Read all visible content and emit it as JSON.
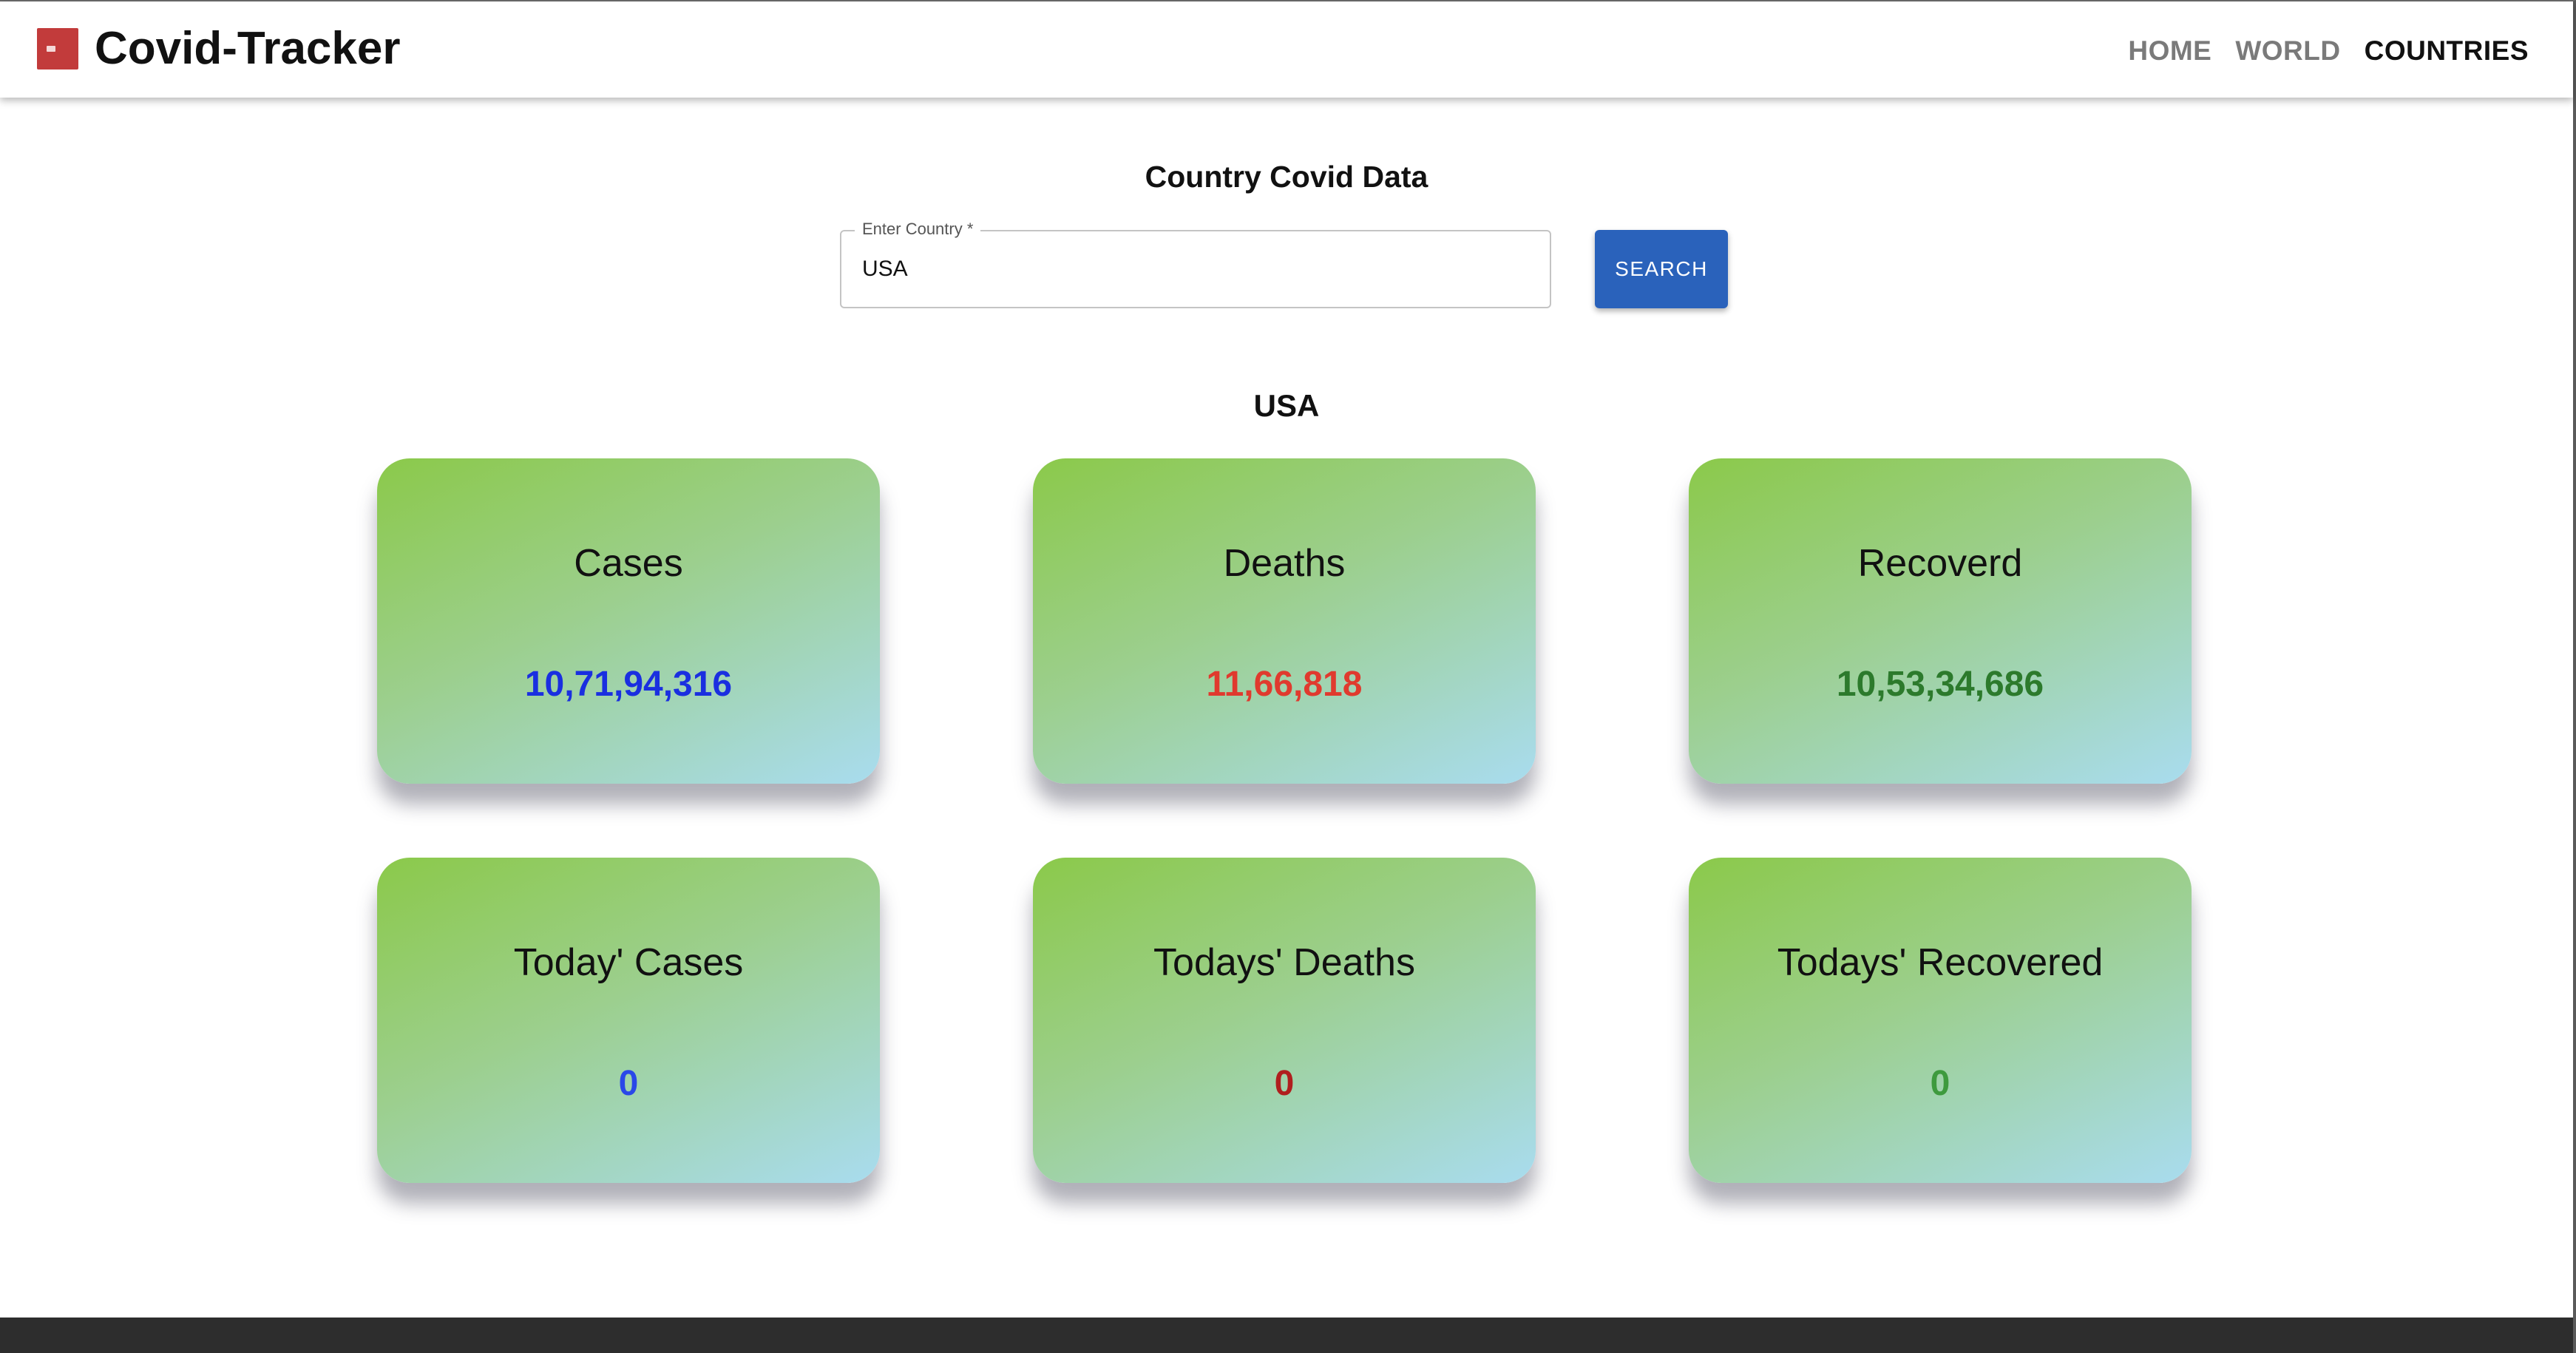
{
  "navbar": {
    "title": "Covid-Tracker",
    "links": [
      {
        "label": "HOME",
        "active": false
      },
      {
        "label": "WORLD",
        "active": false
      },
      {
        "label": "COUNTRIES",
        "active": true
      }
    ]
  },
  "main": {
    "heading": "Country Covid Data",
    "search": {
      "label": "Enter Country *",
      "value": "USA",
      "button_label": "SEARCH"
    },
    "country": "USA",
    "cards": [
      {
        "label": "Cases",
        "value": "10,71,94,316",
        "color": "#1a2fe0"
      },
      {
        "label": "Deaths",
        "value": "11,66,818",
        "color": "#e03a2e"
      },
      {
        "label": "Recoverd",
        "value": "10,53,34,686",
        "color": "#2c7a2c"
      },
      {
        "label": "Today' Cases",
        "value": "0",
        "color": "#2a48e8"
      },
      {
        "label": "Todays' Deaths",
        "value": "0",
        "color": "#b01e1e"
      },
      {
        "label": "Todays' Recovered",
        "value": "0",
        "color": "#3e9a3e"
      }
    ]
  },
  "colors": {
    "search_button": "#2a62bb",
    "card_gradient_start": "#8bc94a",
    "card_gradient_end": "#a9dcef",
    "footer": "#2d2d2d"
  }
}
